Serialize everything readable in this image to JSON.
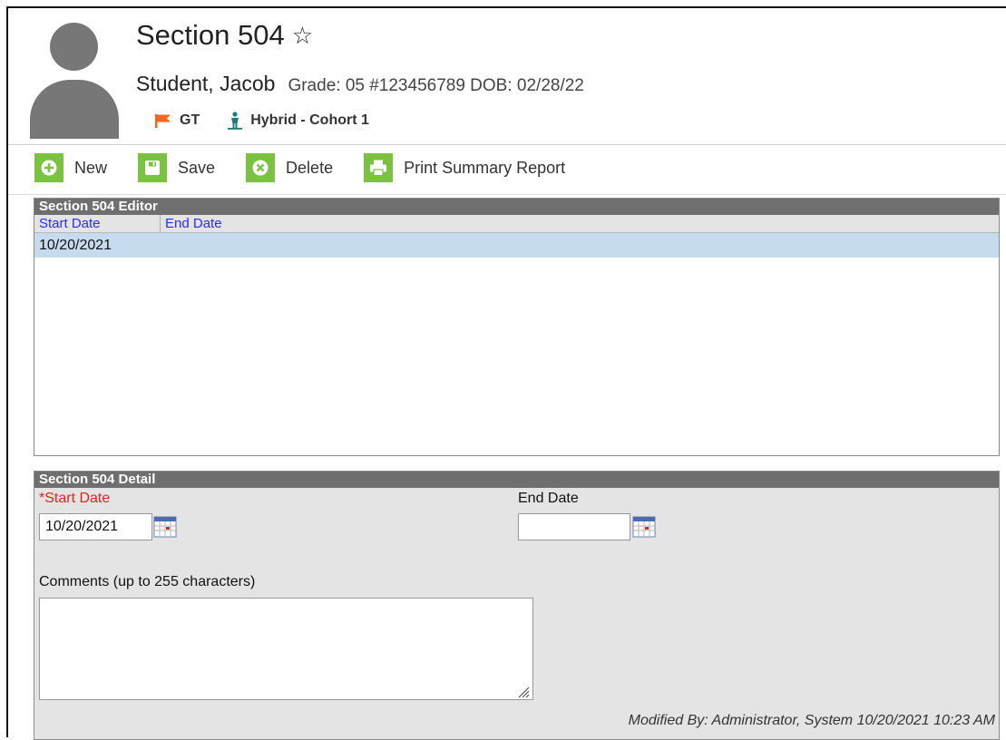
{
  "header": {
    "title": "Section 504",
    "student_name": "Student, Jacob",
    "student_meta": "Grade: 05 #123456789 DOB: 02/28/22",
    "flags": [
      {
        "label": "GT",
        "icon": "flag-icon",
        "color": "#f26522"
      },
      {
        "label": "Hybrid - Cohort 1",
        "icon": "person-icon",
        "color": "#1f7a7a"
      }
    ]
  },
  "toolbar": {
    "new_label": "New",
    "save_label": "Save",
    "delete_label": "Delete",
    "print_label": "Print Summary Report",
    "accent": "#7cc242"
  },
  "editor": {
    "title": "Section 504 Editor",
    "columns": [
      "Start Date",
      "End Date"
    ],
    "rows": [
      {
        "start_date": "10/20/2021",
        "end_date": ""
      }
    ]
  },
  "detail": {
    "title": "Section 504 Detail",
    "start_date_label": "*Start Date",
    "start_date_value": "10/20/2021",
    "end_date_label": "End Date",
    "end_date_value": "",
    "comments_label": "Comments (up to 255 characters)",
    "comments_value": "",
    "modified_by": "Modified By: Administrator, System 10/20/2021 10:23 AM"
  }
}
